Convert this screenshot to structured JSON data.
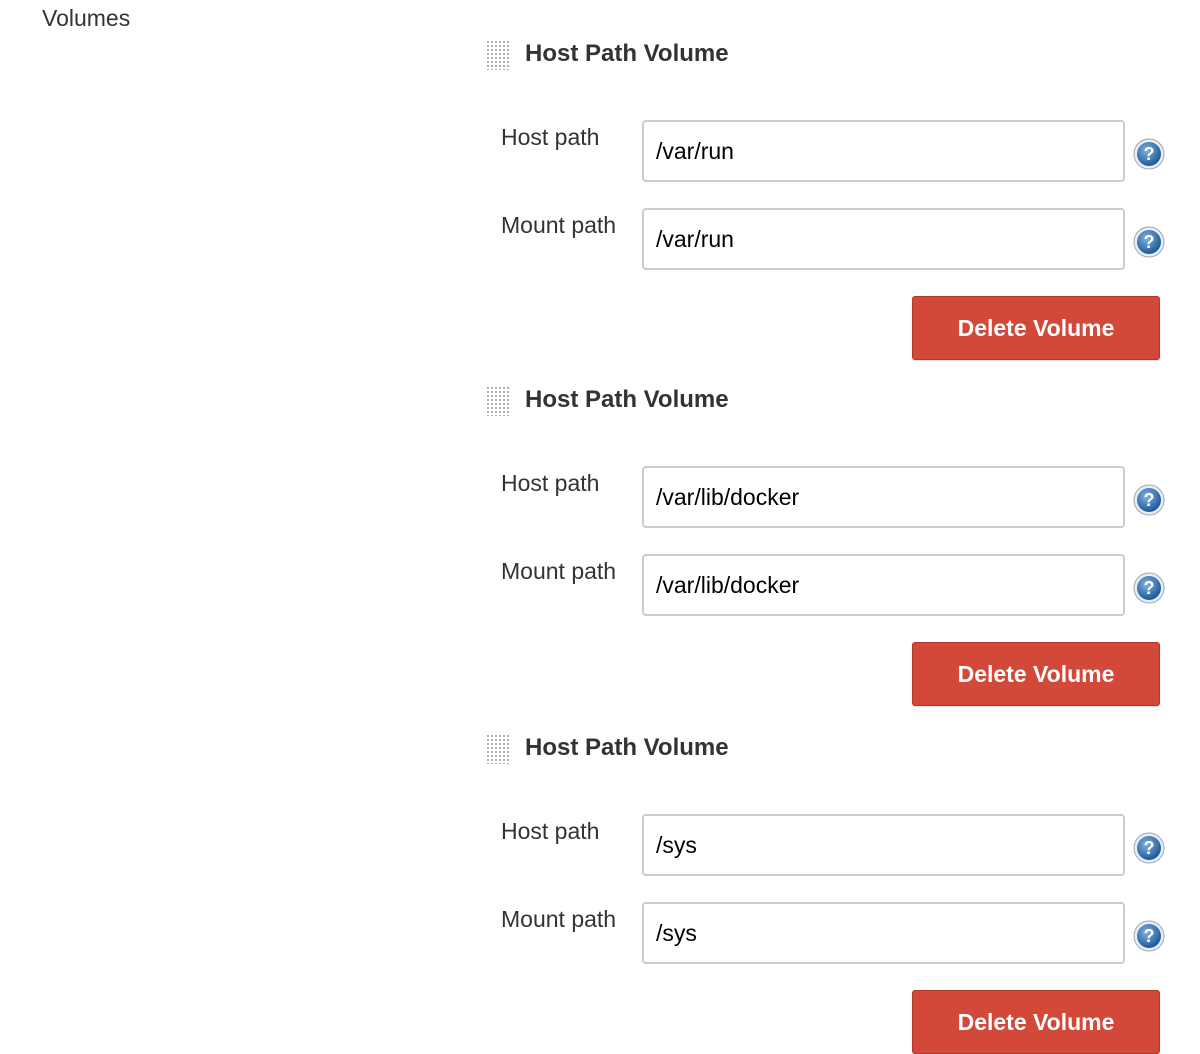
{
  "section": {
    "label": "Volumes"
  },
  "volumes": [
    {
      "title": "Host Path Volume",
      "host_label": "Host path",
      "host_value": "/var/run",
      "mount_label": "Mount path",
      "mount_value": "/var/run",
      "delete_label": "Delete Volume"
    },
    {
      "title": "Host Path Volume",
      "host_label": "Host path",
      "host_value": "/var/lib/docker",
      "mount_label": "Mount path",
      "mount_value": "/var/lib/docker",
      "delete_label": "Delete Volume"
    },
    {
      "title": "Host Path Volume",
      "host_label": "Host path",
      "host_value": "/sys",
      "mount_label": "Mount path",
      "mount_value": "/sys",
      "delete_label": "Delete Volume"
    }
  ],
  "icons": {
    "drag": "drag-handle-icon",
    "help": "help-icon"
  },
  "colors": {
    "delete_button": "#d24939",
    "help_icon": "#2f6fa8",
    "text": "#333333"
  }
}
